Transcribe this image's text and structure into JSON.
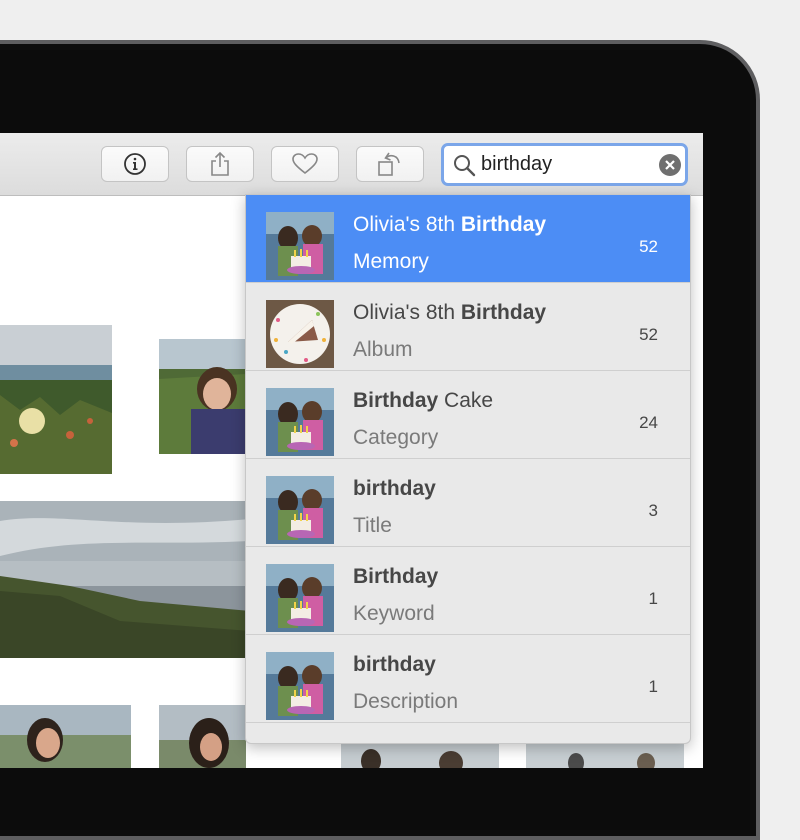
{
  "search": {
    "query": "birthday"
  },
  "results": [
    {
      "prefix": "Olivia's 8th ",
      "bold": "Birthday",
      "suffix": "",
      "type": "Memory",
      "count": "52",
      "thumb": "party"
    },
    {
      "prefix": "Olivia's 8th ",
      "bold": "Birthday",
      "suffix": "",
      "type": "Album",
      "count": "52",
      "thumb": "cake-slice"
    },
    {
      "prefix": "",
      "bold": "Birthday",
      "suffix": " Cake",
      "type": "Category",
      "count": "24",
      "thumb": "party"
    },
    {
      "prefix": "",
      "bold": "birthday",
      "suffix": "",
      "type": "Title",
      "count": "3",
      "thumb": "party"
    },
    {
      "prefix": "",
      "bold": "Birthday",
      "suffix": "",
      "type": "Keyword",
      "count": "1",
      "thumb": "party"
    },
    {
      "prefix": "",
      "bold": "birthday",
      "suffix": "",
      "type": "Description",
      "count": "1",
      "thumb": "party"
    }
  ],
  "colors": {
    "selection": "#4c8df5",
    "search_focus": "#7ba6e9"
  },
  "icons": [
    "info-icon",
    "share-icon",
    "heart-icon",
    "rotate-icon",
    "search-icon",
    "clear-icon"
  ]
}
